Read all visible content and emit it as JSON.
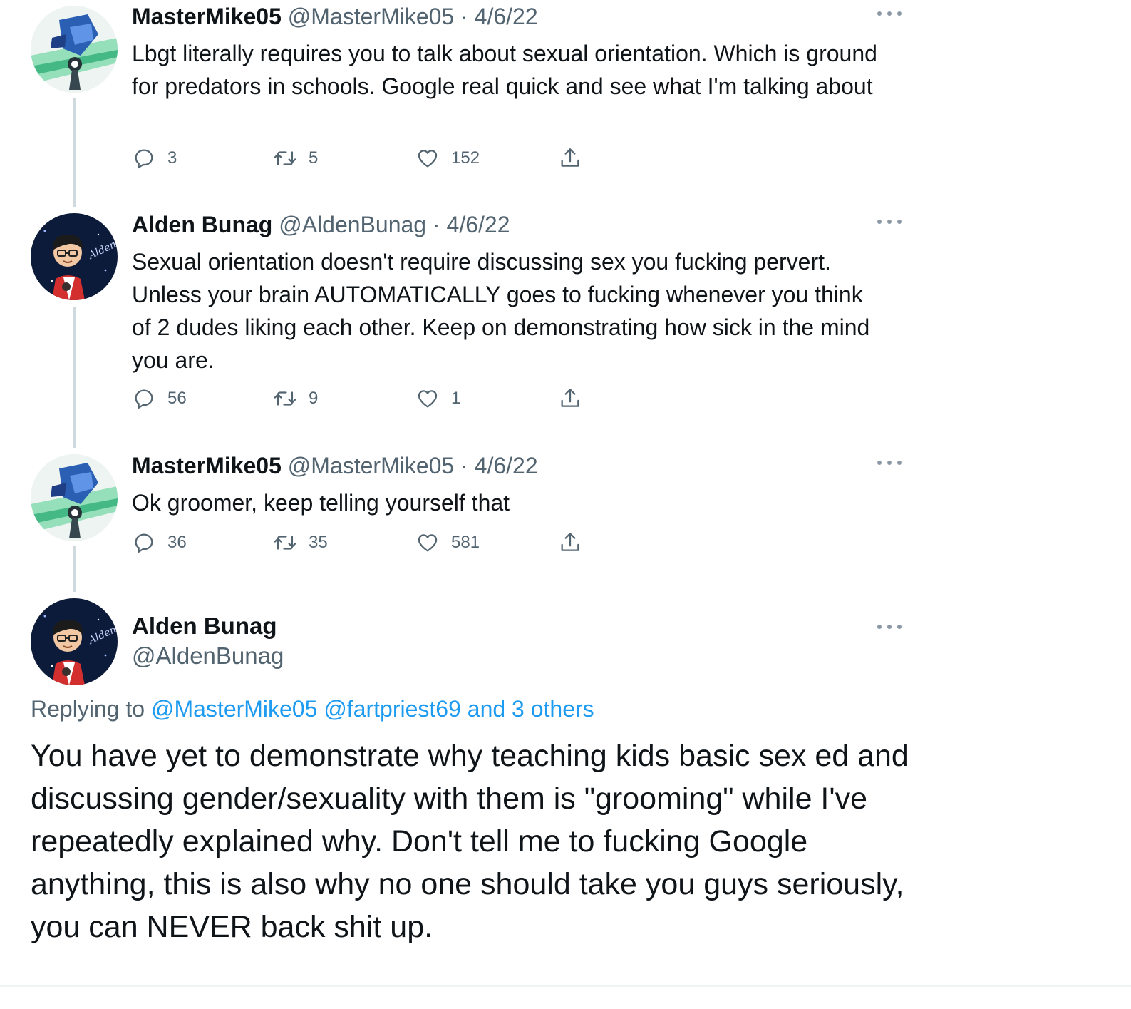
{
  "tweets": [
    {
      "name": "MasterMike05",
      "handle": "@MasterMike05",
      "separator": "·",
      "date": "4/6/22",
      "text": "Lbgt literally requires you to talk about sexual orientation. Which is ground for predators in schools. Google real quick and see what I'm talking about",
      "replies": "3",
      "retweets": "5",
      "likes": "152",
      "avatar_icon": "robot-character-avatar"
    },
    {
      "name": "Alden Bunag",
      "handle": "@AldenBunag",
      "separator": "·",
      "date": "4/6/22",
      "text": "Sexual orientation doesn't require discussing sex you fucking pervert. Unless your brain AUTOMATICALLY goes to fucking whenever you think of 2 dudes liking each other. Keep on demonstrating how sick in the mind you are.",
      "replies": "56",
      "retweets": "9",
      "likes": "1",
      "avatar_icon": "cartoon-person-avatar"
    },
    {
      "name": "MasterMike05",
      "handle": "@MasterMike05",
      "separator": "·",
      "date": "4/6/22",
      "text": "Ok groomer, keep telling yourself that",
      "replies": "36",
      "retweets": "35",
      "likes": "581",
      "avatar_icon": "robot-character-avatar"
    }
  ],
  "focus_tweet": {
    "name": "Alden Bunag",
    "handle": "@AldenBunag",
    "replying_prefix": "Replying to",
    "replying_links": "@MasterMike05 @fartpriest69 and 3 others",
    "text": "You have yet to demonstrate why teaching kids basic sex ed and discussing gender/sexuality with them is \"grooming\" while I've repeatedly explained why. Don't tell me to fucking Google anything, this is also why no one should take you guys seriously, you can NEVER back shit up.",
    "avatar_icon": "cartoon-person-avatar",
    "avatar_signature": "Alden"
  },
  "icons": {
    "reply": "reply-bubble-icon",
    "retweet": "retweet-arrows-icon",
    "like": "heart-icon",
    "share": "share-upload-icon",
    "more": "more-dots-icon"
  },
  "colors": {
    "text": "#0f1419",
    "secondary": "#536471",
    "link": "#1d9bf0",
    "thread_line": "#cfd9de"
  }
}
